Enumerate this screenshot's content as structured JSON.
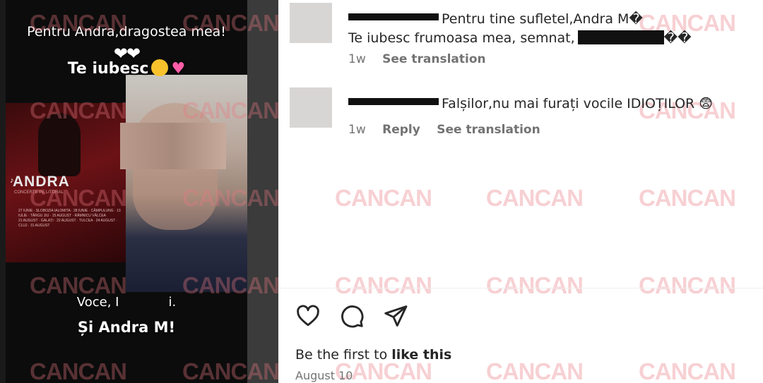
{
  "video": {
    "line1": "Pentru Andra,dragostea mea!",
    "hearts": "❤❤",
    "line2": "Te iubesc",
    "line3": "Voce, I",
    "line3_end": "i.",
    "line4": "Și Andra M!",
    "poster": {
      "brand": "ANDRA",
      "subtitle": "CONCERTE PE LITORAL",
      "tiktok": "♪",
      "dates_left": "27 IUNIE · SLOBOZIA IALOMITA · 28 IUNIE · CÂMPULUNG · 13 IULIE · TÂRGU JIU · 15 AUGUST · RÂMNICU VÂLCEA",
      "dates_right": "21 AUGUST · GALAȚI · 22 AUGUST · TULCEA · 24 AUGUST · CLUJ · 31 AUGUST"
    }
  },
  "watermark": "CANCAN",
  "comments": [
    {
      "line1": "Pentru tine sufletel,Andra M�",
      "line2_start": "Te iubesc frumoasa mea, semnat,",
      "line2_end": "��",
      "time": "1w",
      "actions": [
        "See translation"
      ]
    },
    {
      "line1": "Falșilor,nu mai furați vocile IDIOȚILOR 😨",
      "time": "1w",
      "actions": [
        "Reply",
        "See translation"
      ]
    }
  ],
  "post": {
    "likes_prefix": "Be the first to ",
    "likes_action": "like this",
    "date": "August 10"
  },
  "icons": {
    "like": "heart-icon",
    "comment": "comment-icon",
    "share": "share-icon"
  }
}
